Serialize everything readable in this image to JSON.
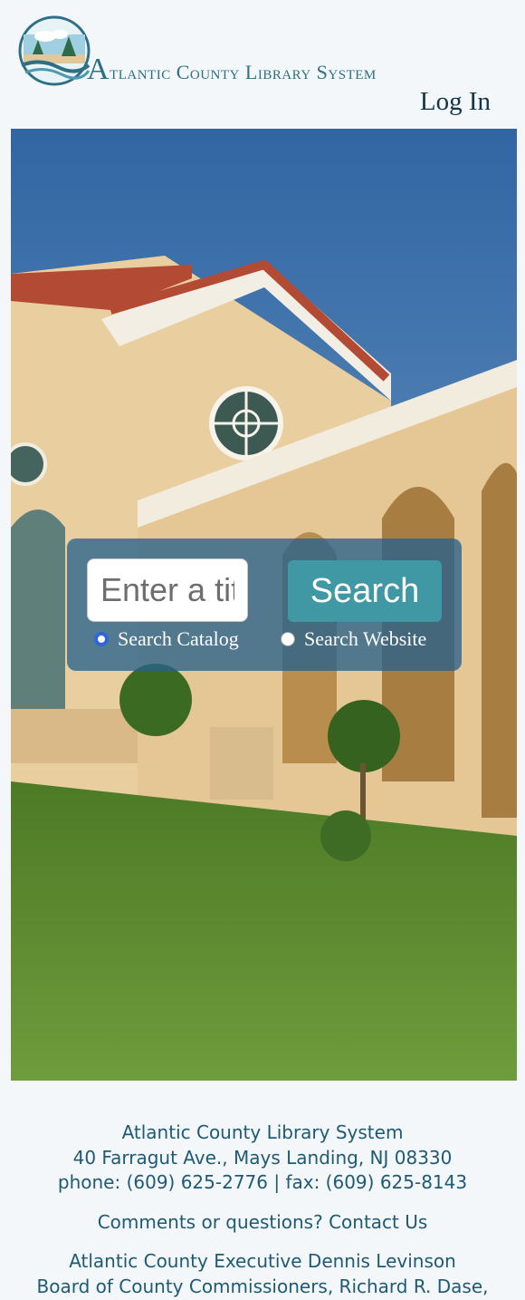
{
  "header": {
    "logo_text_initial": "A",
    "logo_text_rest": "tlantic County Library System",
    "login_label": "Log In"
  },
  "search": {
    "placeholder": "Enter a title, author, subject...",
    "button_label": "Search",
    "option_catalog": "Search Catalog",
    "option_website": "Search Website",
    "selected_option": "catalog"
  },
  "footer": {
    "org_name": "Atlantic County Library System",
    "address": "40 Farragut Ave., Mays Landing, NJ 08330",
    "phone_fax": "phone: (609) 625-2776 | fax: (609) 625-8143",
    "contact_prefix": "Comments or questions? ",
    "contact_link": "Contact Us",
    "executive": "Atlantic County Executive Dennis Levinson",
    "commissioners": "Board of County Commissioners, Richard R. Dase,"
  },
  "colors": {
    "brand": "#2d6f85",
    "search_button": "#3f98a4",
    "panel": "#28628c",
    "footer_text": "#1e5a74"
  }
}
